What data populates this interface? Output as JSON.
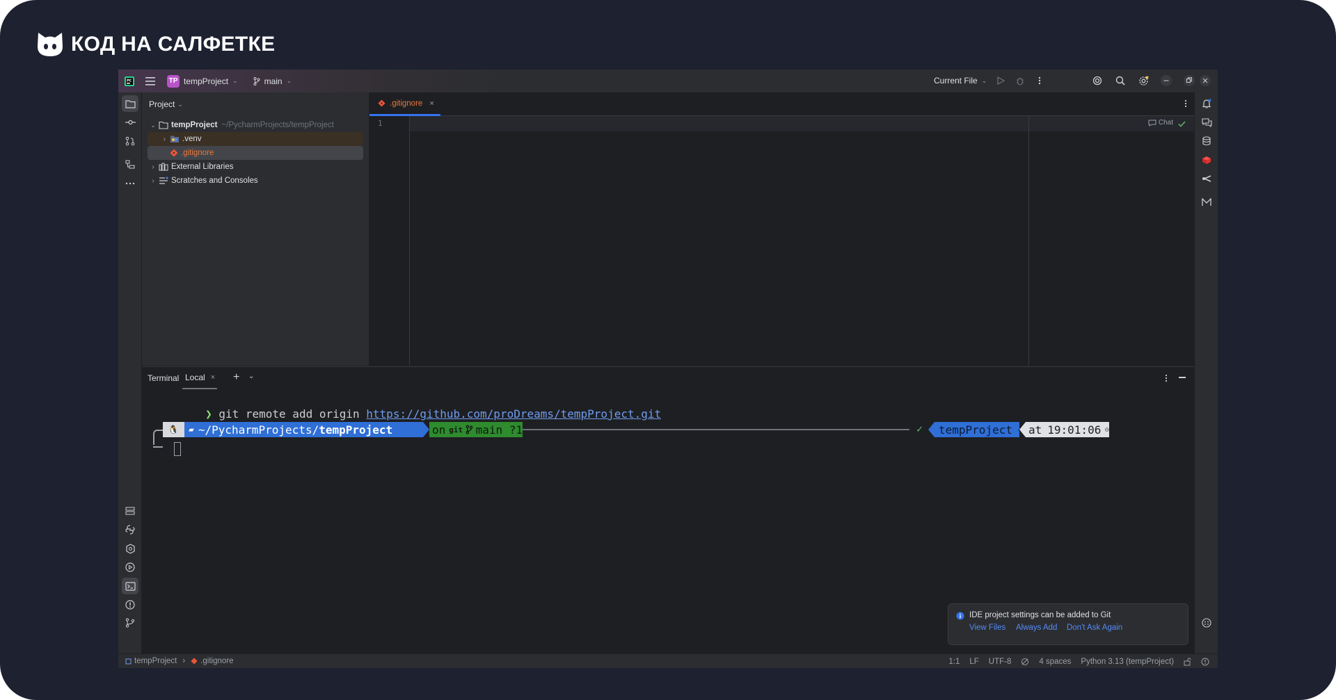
{
  "brand": {
    "name": "КОД НА САЛФЕТКЕ",
    "logo": "cat-head-logo"
  },
  "titlebar": {
    "project_initials": "TP",
    "project_name": "tempProject",
    "branch": "main",
    "run_config": "Current File"
  },
  "project_panel": {
    "title": "Project",
    "tree": [
      {
        "label": "tempProject",
        "path": "~/PycharmProjects/tempProject",
        "icon": "folder-icon",
        "expanded": true
      },
      {
        "label": ".venv",
        "icon": "python-folder-icon"
      },
      {
        "label": ".gitignore",
        "icon": "git-file-icon",
        "selected": true
      },
      {
        "label": "External Libraries",
        "icon": "library-icon"
      },
      {
        "label": "Scratches and Consoles",
        "icon": "scratches-icon"
      }
    ]
  },
  "editor": {
    "tab_label": ".gitignore",
    "line_number": "1",
    "chat_label": "Chat"
  },
  "terminal": {
    "title": "Terminal",
    "tab_local": "Local",
    "command_prompt": "❯",
    "command": "git remote add origin",
    "command_url": "https://github.com/proDreams/tempProject.git",
    "prompt": {
      "os_icon": "🐧",
      "path_prefix": "~/PycharmProjects/",
      "path_dir": "tempProject",
      "git_on": "on",
      "git_label": "git",
      "branch": "main ?1",
      "status_check": "✓",
      "env": "tempProject",
      "time_prefix": "at",
      "time": "19:01:06"
    }
  },
  "notification": {
    "message": "IDE project settings can be added to Git",
    "actions": [
      "View Files",
      "Always Add",
      "Don't Ask Again"
    ]
  },
  "statusbar": {
    "breadcrumb_project": "tempProject",
    "breadcrumb_file": ".gitignore",
    "position": "1:1",
    "line_sep": "LF",
    "encoding": "UTF-8",
    "indent": "4 spaces",
    "interpreter": "Python 3.13 (tempProject)"
  },
  "colors": {
    "frame": "#1d2130",
    "ide_bg": "#1e1f22",
    "panel_bg": "#2b2d30",
    "accent": "#3574f0",
    "path_seg": "#2f6fd6",
    "git_seg": "#2e8b2e",
    "env_seg": "#2f6fd6",
    "time_seg": "#dfe1e5"
  }
}
